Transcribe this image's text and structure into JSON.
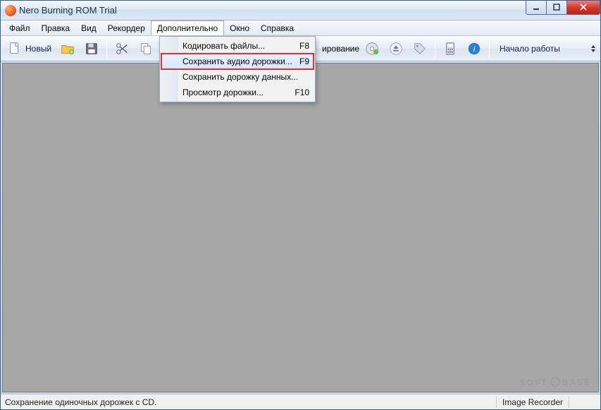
{
  "titlebar": {
    "title": "Nero Burning ROM Trial"
  },
  "menu": {
    "items": [
      {
        "label": "Файл"
      },
      {
        "label": "Правка"
      },
      {
        "label": "Вид"
      },
      {
        "label": "Рекордер"
      },
      {
        "label": "Дополнительно",
        "open": true
      },
      {
        "label": "Окно"
      },
      {
        "label": "Справка"
      }
    ]
  },
  "dropdown": {
    "items": [
      {
        "label": "Кодировать файлы...",
        "shortcut": "F8"
      },
      {
        "label": "Сохранить аудио дорожки...",
        "shortcut": "F9",
        "highlight": true
      },
      {
        "label": "Сохранить дорожку данных...",
        "shortcut": ""
      },
      {
        "label": "Просмотр дорожки...",
        "shortcut": "F10"
      }
    ]
  },
  "toolbar": {
    "new_label": "Новый",
    "copy_label": "ирование",
    "start_label": "Начало работы"
  },
  "status": {
    "left": "Сохранение одиночных дорожек с CD.",
    "recorder": "Image Recorder"
  },
  "watermark": {
    "left": "SOFT",
    "right": "BASE"
  }
}
